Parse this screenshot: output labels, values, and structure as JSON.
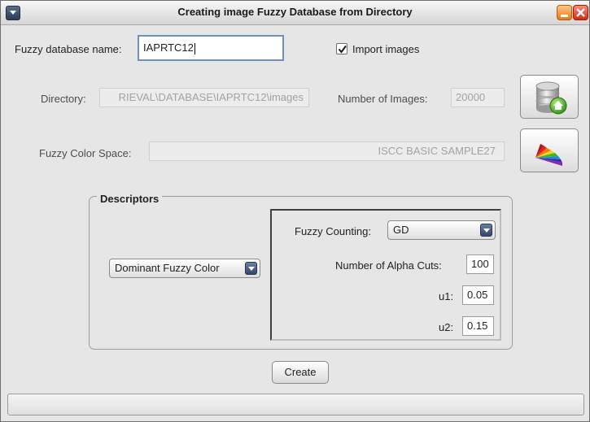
{
  "window": {
    "title": "Creating image Fuzzy Database from Directory"
  },
  "form": {
    "db_name_label": "Fuzzy database name:",
    "db_name_value": "IAPRTC12",
    "import_images_label": "Import images",
    "import_images_checked": true,
    "directory_label": "Directory:",
    "directory_value": "RIEVAL\\DATABASE\\IAPRTC12\\images",
    "num_images_label": "Number of Images:",
    "num_images_value": "20000",
    "color_space_label": "Fuzzy Color Space:",
    "color_space_value": "ISCC  BASIC  SAMPLE27"
  },
  "buttons": {
    "database_icon": "database-home-icon",
    "color_space_icon": "color-fan-icon",
    "create_label": "Create"
  },
  "descriptors": {
    "group_title": "Descriptors",
    "descriptor_selected": "Dominant Fuzzy Color",
    "fuzzy_counting_label": "Fuzzy Counting:",
    "fuzzy_counting_selected": "GD",
    "alpha_cuts_label": "Number of Alpha Cuts:",
    "alpha_cuts_value": "100",
    "u1_label": "u1:",
    "u1_value": "0.05",
    "u2_label": "u2:",
    "u2_value": "0.15"
  },
  "colors": {
    "window_bg": "#e6e6e6",
    "minimize": "#e57b12",
    "close": "#d42a13",
    "combo_arrow": "#34476b"
  }
}
